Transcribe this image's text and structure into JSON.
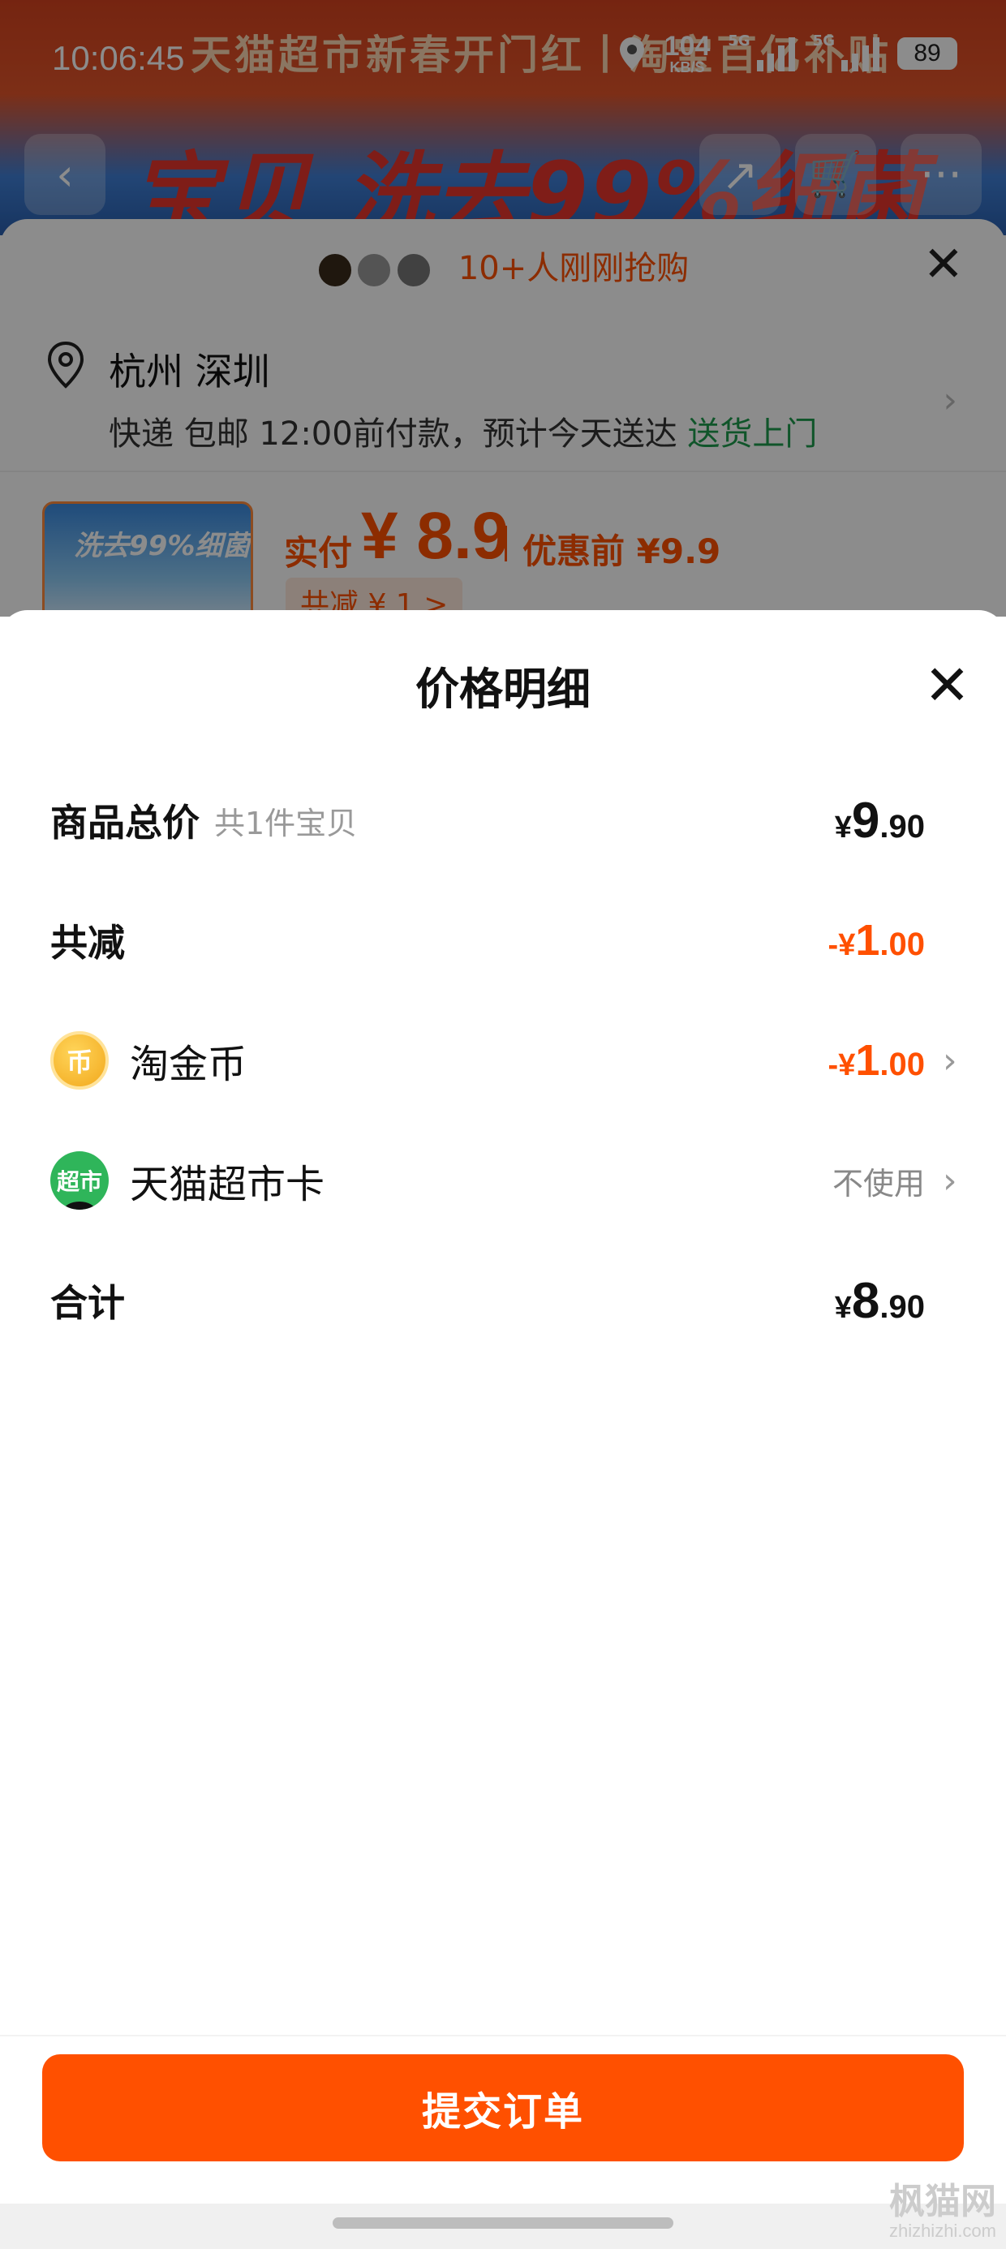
{
  "status_bar": {
    "time": "10:06:45",
    "net_speed_value": "104",
    "net_speed_unit": "KB/S",
    "signal_label_1": "5G",
    "signal_label_2": "5G",
    "battery": "89"
  },
  "background": {
    "banner_top": "天猫超市新春开门红丨淘宝百亿补贴",
    "banner_big": "宝贝 洗去99%细菌",
    "buyers_text": "10+人刚刚抢购",
    "address_city": "杭州 深圳",
    "shipping_text": "快递 包邮 12:00前付款，预计今天送达 ",
    "shipping_highlight": "送货上门",
    "product_thumb_text": "洗去99%细菌",
    "paid_label": "实付",
    "paid_value": "¥ 8.9",
    "orig_price": "优惠前 ¥9.9",
    "cut_tag": "共减 ¥ 1 >"
  },
  "sheet": {
    "title": "价格明细",
    "rows": {
      "total": {
        "label": "商品总价",
        "sub": "共1件宝贝",
        "currency": "¥",
        "int": "9",
        "dec": ".90"
      },
      "reduce": {
        "label": "共减",
        "currency": "-¥",
        "int": "1",
        "dec": ".00"
      },
      "coin": {
        "label": "淘金币",
        "icon_text": "币",
        "currency": "-¥",
        "int": "1",
        "dec": ".00"
      },
      "card": {
        "label": "天猫超市卡",
        "icon_text": "超市",
        "value": "不使用"
      },
      "sum": {
        "label": "合计",
        "currency": "¥",
        "int": "8",
        "dec": ".90"
      }
    },
    "submit": "提交订单"
  },
  "watermark": {
    "line1": "枫猫网",
    "line2": "zhizhizhi.com"
  },
  "colors": {
    "accent": "#ff5000",
    "green": "#1e9b4e"
  }
}
